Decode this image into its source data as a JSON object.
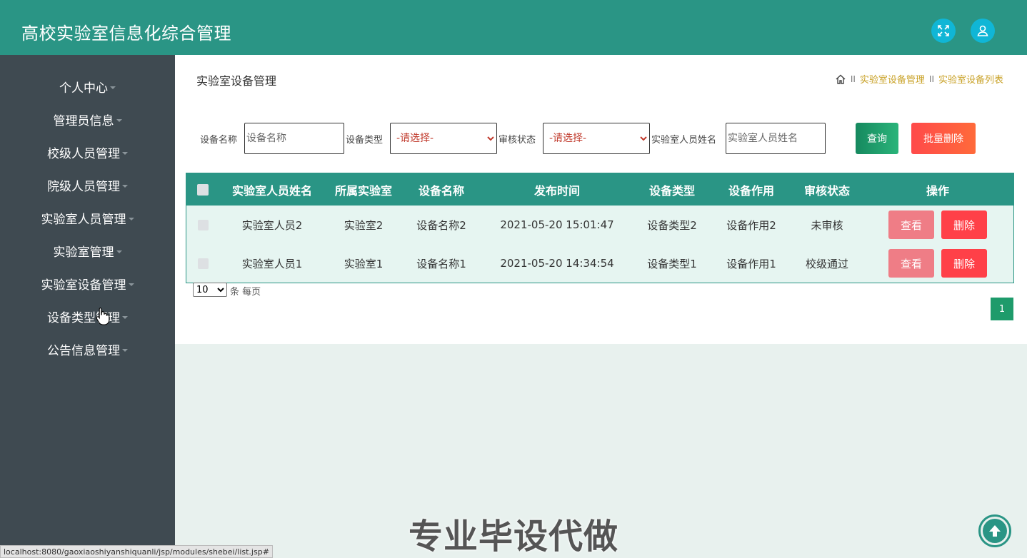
{
  "header": {
    "title": "高校实验室信息化综合管理",
    "fullscreen_icon": "expand-icon",
    "user_icon": "user-icon"
  },
  "sidebar": {
    "items": [
      {
        "label": "个人中心"
      },
      {
        "label": "管理员信息"
      },
      {
        "label": "校级人员管理"
      },
      {
        "label": "院级人员管理"
      },
      {
        "label": "实验室人员管理"
      },
      {
        "label": "实验室管理"
      },
      {
        "label": "实验室设备管理"
      },
      {
        "label": "设备类型管理"
      },
      {
        "label": "公告信息管理"
      }
    ]
  },
  "page": {
    "title": "实验室设备管理",
    "breadcrumb": {
      "sep": "II",
      "items": [
        "实验室设备管理",
        "实验室设备列表"
      ]
    }
  },
  "search": {
    "name_label": "设备名称",
    "name_placeholder": "设备名称",
    "type_label": "设备类型",
    "type_selected": "-请选择-",
    "status_label": "审核状态",
    "status_selected": "-请选择-",
    "person_label": "实验室人员姓名",
    "person_placeholder": "实验室人员姓名",
    "query_label": "查询",
    "batch_delete_label": "批量删除"
  },
  "table": {
    "columns": [
      "实验室人员姓名",
      "所属实验室",
      "设备名称",
      "发布时间",
      "设备类型",
      "设备作用",
      "审核状态",
      "操作"
    ],
    "rows": [
      {
        "person": "实验室人员2",
        "lab": "实验室2",
        "name": "设备名称2",
        "time": "2021-05-20 15:01:47",
        "type": "设备类型2",
        "purpose": "设备作用2",
        "status": "未审核"
      },
      {
        "person": "实验室人员1",
        "lab": "实验室1",
        "name": "设备名称1",
        "time": "2021-05-20 14:34:54",
        "type": "设备类型1",
        "purpose": "设备作用1",
        "status": "校级通过"
      }
    ],
    "view_label": "查看",
    "delete_label": "删除"
  },
  "pagination": {
    "page_size": "10",
    "page_size_suffix": "条 每页",
    "current_page": "1"
  },
  "watermark": "专业毕设代做",
  "statusbar": "localhost:8080/gaoxiaoshiyanshiquanli/jsp/modules/shebei/list.jsp#",
  "colors": {
    "primary": "#2a9585",
    "sidebar": "#3f4a51",
    "danger": "#ff4048",
    "view": "#ef7d86",
    "breadcrumb": "#c9a227"
  }
}
